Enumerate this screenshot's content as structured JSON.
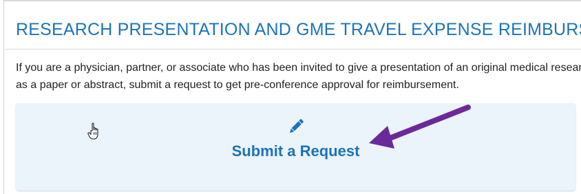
{
  "card": {
    "title": "RESEARCH PRESENTATION AND GME TRAVEL EXPENSE REIMBURSEMENT",
    "description_line1": "If you are a physician, partner, or associate who has been invited to give a presentation of an original medical research, such",
    "description_line2": "as a paper or abstract, submit a request to get pre-conference approval for reimbursement."
  },
  "action": {
    "label": "Submit a Request",
    "icon": "pencil-icon"
  },
  "colors": {
    "accent": "#1b74b8",
    "panel_bg": "#ebf3fb",
    "annotation_arrow": "#6b2a9a"
  }
}
